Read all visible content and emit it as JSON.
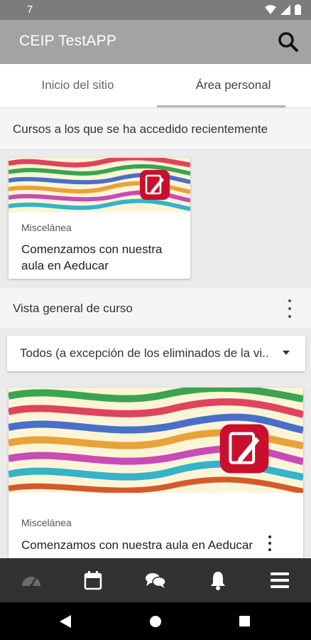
{
  "status_bar": {
    "time": "7"
  },
  "app_bar": {
    "title": "CEIP TestAPP",
    "search_icon": "search-icon"
  },
  "tabs": [
    {
      "label": "Inicio del sitio",
      "selected": false
    },
    {
      "label": "Área personal",
      "selected": true
    }
  ],
  "recent": {
    "header": "Cursos a los que se ha accedido recientemente",
    "course": {
      "category": "Miscelánea",
      "name": "Comenzamos con nuestra aula en Aeducar"
    }
  },
  "overview": {
    "header": "Vista general de curso",
    "filter_value": "Todos (a excepción de los eliminados de la vista)",
    "course": {
      "category": "Miscelánea",
      "name": "Comenzamos con nuestra aula en Aeducar"
    }
  },
  "bottom_nav": [
    {
      "icon": "dashboard-icon"
    },
    {
      "icon": "calendar-icon"
    },
    {
      "icon": "messages-icon"
    },
    {
      "icon": "notifications-icon"
    },
    {
      "icon": "menu-icon"
    }
  ],
  "colors": {
    "app_bar": "#a3a3a3",
    "status_bar": "#7c7c7c",
    "bottom_nav": "#323232",
    "badge": "#c8102e"
  }
}
